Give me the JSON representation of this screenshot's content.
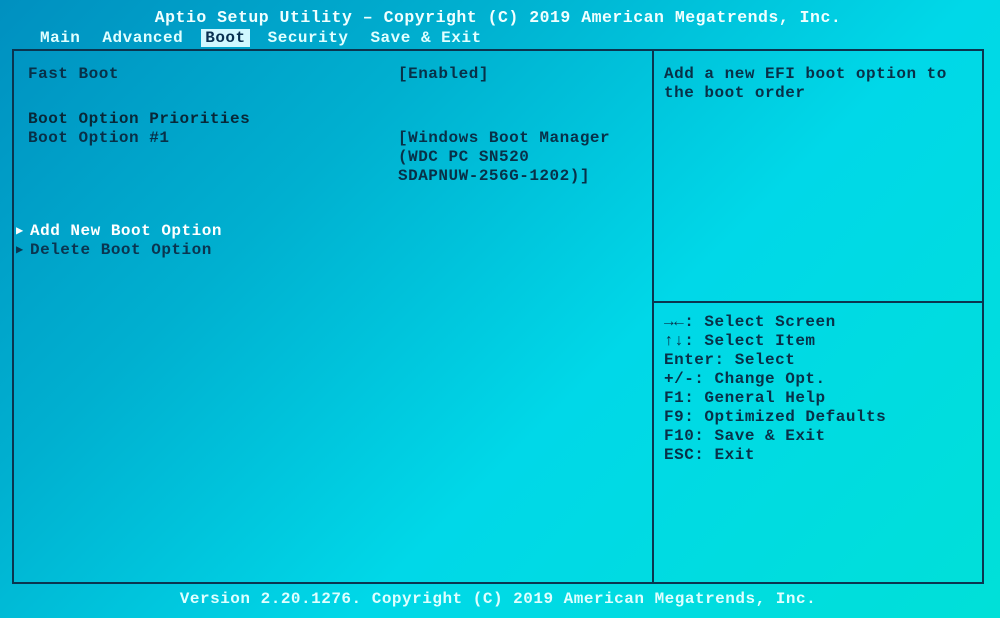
{
  "title": "Aptio Setup Utility – Copyright (C) 2019 American Megatrends, Inc.",
  "menu": {
    "main": "Main",
    "advanced": "Advanced",
    "boot": "Boot",
    "security": "Security",
    "save_exit": "Save & Exit"
  },
  "boot_page": {
    "fast_boot_label": "Fast Boot",
    "fast_boot_value": "[Enabled]",
    "priorities_header": "Boot Option Priorities",
    "opt1_label": "Boot Option #1",
    "opt1_value_l1": "[Windows Boot Manager",
    "opt1_value_l2": "(WDC PC SN520",
    "opt1_value_l3": "SDAPNUW-256G-1202)]",
    "add_new": "Add New Boot Option",
    "delete": "Delete Boot Option"
  },
  "help_text_l1": "Add a new EFI boot option to",
  "help_text_l2": "the boot order",
  "keyhelp": {
    "l1": "→←: Select Screen",
    "l2": "↑↓: Select Item",
    "l3": "Enter: Select",
    "l4": "+/-: Change Opt.",
    "l5": "F1: General Help",
    "l6": "F9: Optimized Defaults",
    "l7": "F10: Save & Exit",
    "l8": "ESC: Exit"
  },
  "footer": "Version 2.20.1276. Copyright (C) 2019 American Megatrends, Inc."
}
